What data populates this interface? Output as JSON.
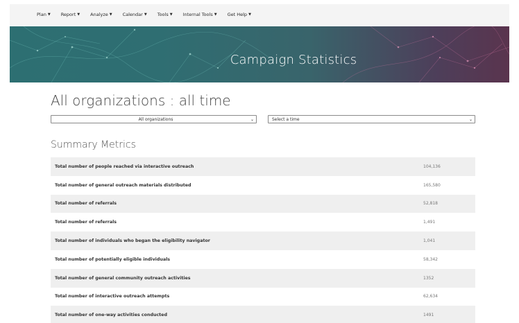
{
  "nav": {
    "items": [
      {
        "label": "Plan"
      },
      {
        "label": "Report"
      },
      {
        "label": "Analyze"
      },
      {
        "label": "Calendar"
      },
      {
        "label": "Tools"
      },
      {
        "label": "Internal Tools"
      },
      {
        "label": "Get Help"
      }
    ],
    "caret_icon": "chevron-down-icon"
  },
  "hero": {
    "title": "Campaign Statistics"
  },
  "page": {
    "heading": "All organizations : all time"
  },
  "filters": {
    "organization": {
      "selected": "All organizations"
    },
    "time": {
      "selected": "Select a time"
    }
  },
  "summary": {
    "title": "Summary Metrics",
    "rows": [
      {
        "label": "Total number of people reached via interactive outreach",
        "value": "104,136"
      },
      {
        "label": "Total number of general outreach materials distributed",
        "value": "165,580"
      },
      {
        "label": "Total number of referrals",
        "value": "52,818"
      },
      {
        "label": "Total number of referrals",
        "value": "1,491"
      },
      {
        "label": "Total number of individuals who began the eligibility navigator",
        "value": "1,041"
      },
      {
        "label": "Total number of potentially eligible individuals",
        "value": "58,342"
      },
      {
        "label": "Total number of general community outreach activities",
        "value": "1352"
      },
      {
        "label": "Total number of interactive outreach attempts",
        "value": "62,634"
      },
      {
        "label": "Total number of one-way activities conducted",
        "value": "1491"
      }
    ]
  },
  "colors": {
    "hero_teal": "#2d6f72",
    "hero_magenta": "#5a344e",
    "row_stripe": "#efefef"
  }
}
